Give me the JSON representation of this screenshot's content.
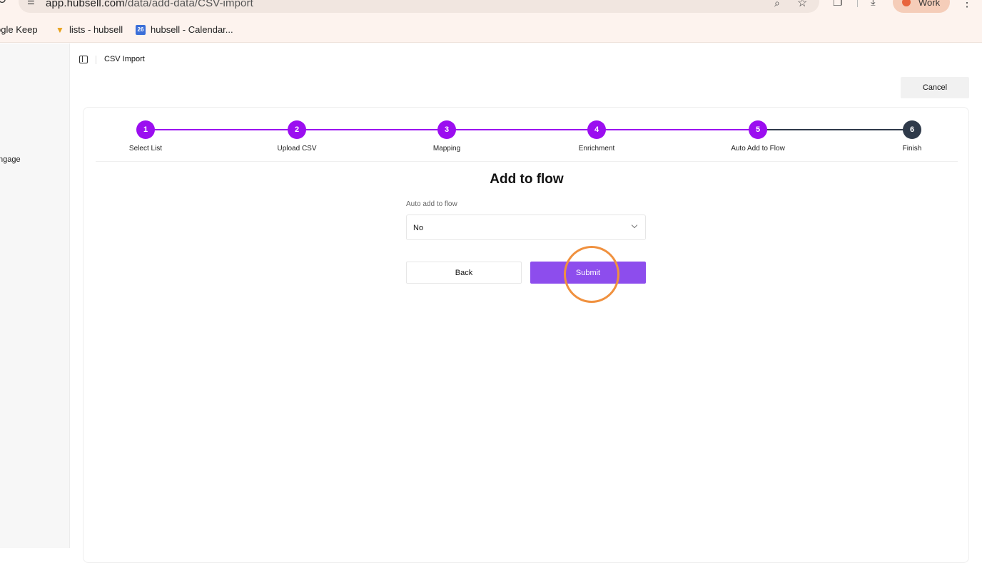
{
  "browser": {
    "url_main": "app.hubsell.com",
    "url_path": "/data/add-data/CSV-import",
    "profile_label": "Work",
    "icons": {
      "reload": "reload-icon",
      "site_settings": "site-settings-icon",
      "zoom": "zoom-icon",
      "star": "star-icon",
      "extensions": "extensions-icon",
      "download": "download-icon",
      "menu": "kebab-menu-icon"
    },
    "bookmarks": [
      {
        "label": "ogle Keep"
      },
      {
        "label": "lists - hubsell"
      },
      {
        "label": "hubsell - Calendar...",
        "icon_text": "26"
      }
    ]
  },
  "sidebar": {
    "items": [
      {
        "label": "ngage"
      }
    ]
  },
  "header": {
    "breadcrumb": "CSV Import",
    "cancel_label": "Cancel"
  },
  "stepper": {
    "active_color": "#9b0ef0",
    "inactive_color": "#2f3a4a",
    "current_step": 5,
    "steps": [
      {
        "number": "1",
        "label": "Select List",
        "state": "done"
      },
      {
        "number": "2",
        "label": "Upload CSV",
        "state": "done"
      },
      {
        "number": "3",
        "label": "Mapping",
        "state": "done"
      },
      {
        "number": "4",
        "label": "Enrichment",
        "state": "done"
      },
      {
        "number": "5",
        "label": "Auto Add to Flow",
        "state": "current"
      },
      {
        "number": "6",
        "label": "Finish",
        "state": "pending"
      }
    ]
  },
  "form": {
    "title": "Add to flow",
    "field_label": "Auto add to flow",
    "select_value": "No",
    "back_label": "Back",
    "submit_label": "Submit",
    "submit_color": "#8d4ded"
  }
}
